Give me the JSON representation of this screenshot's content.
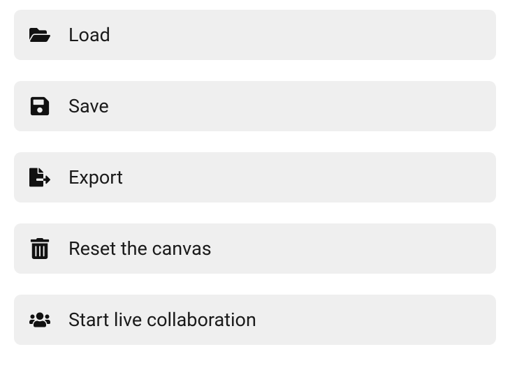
{
  "menu": {
    "items": [
      {
        "id": "load",
        "label": "Load",
        "icon": "folder-open-icon"
      },
      {
        "id": "save",
        "label": "Save",
        "icon": "floppy-disk-icon"
      },
      {
        "id": "export",
        "label": "Export",
        "icon": "file-export-icon"
      },
      {
        "id": "reset",
        "label": "Reset the canvas",
        "icon": "trash-icon"
      },
      {
        "id": "collab",
        "label": "Start live collaboration",
        "icon": "users-icon"
      }
    ]
  }
}
